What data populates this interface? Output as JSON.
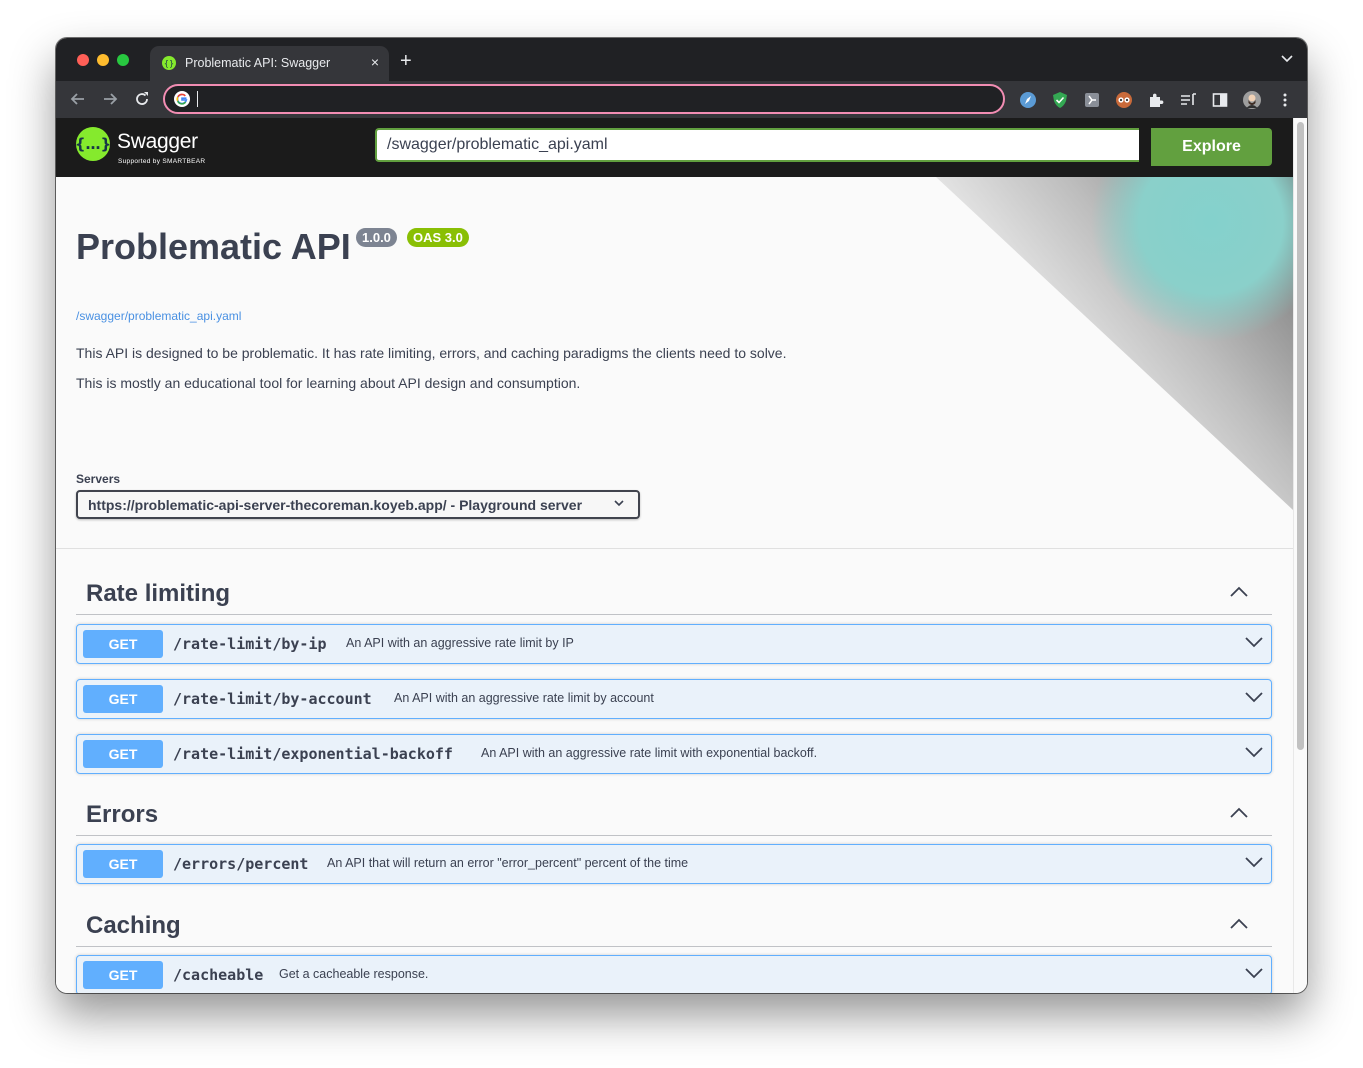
{
  "browser": {
    "tab_title": "Problematic API: Swagger",
    "tab_close": "×",
    "new_tab": "+",
    "omnibox_value": "",
    "colors": {
      "frame": "#202124",
      "toolbar": "#35363a",
      "omnibox_focus": "#f28db3"
    }
  },
  "swagger": {
    "logo_text": "Swagger",
    "logo_sub": "Supported by SMARTBEAR",
    "url_value": "/swagger/problematic_api.yaml",
    "explore_label": "Explore",
    "colors": {
      "topbar": "#1b1b1b",
      "brand_green": "#85ea2d",
      "explore": "#62a03f"
    }
  },
  "info": {
    "title": "Problematic API",
    "version": "1.0.0",
    "oas": "OAS 3.0",
    "spec_link": "/swagger/problematic_api.yaml",
    "description_1": "This API is designed to be problematic. It has rate limiting, errors, and caching paradigms the clients need to solve.",
    "description_2": "This is mostly an educational tool for learning about API design and consumption."
  },
  "servers": {
    "label": "Servers",
    "selected": "https://problematic-api-server-thecoreman.koyeb.app/ - Playground server"
  },
  "tags": [
    {
      "name": "Rate limiting",
      "operations": [
        {
          "method": "GET",
          "path": "/rate-limit/by-ip",
          "summary": "An API with an aggressive rate limit by IP"
        },
        {
          "method": "GET",
          "path": "/rate-limit/by-account",
          "summary": "An API with an aggressive rate limit by account"
        },
        {
          "method": "GET",
          "path": "/rate-limit/exponential-backoff",
          "summary": "An API with an aggressive rate limit with exponential backoff."
        }
      ]
    },
    {
      "name": "Errors",
      "operations": [
        {
          "method": "GET",
          "path": "/errors/percent",
          "summary": "An API that will return an error \"error_percent\" percent of the time"
        }
      ]
    },
    {
      "name": "Caching",
      "operations": [
        {
          "method": "GET",
          "path": "/cacheable",
          "summary": "Get a cacheable response."
        }
      ]
    }
  ],
  "colors": {
    "get": "#61affe",
    "text": "#3b4151",
    "link": "#4990e2",
    "version_badge": "#7d8492",
    "oas_badge": "#89bf04"
  }
}
